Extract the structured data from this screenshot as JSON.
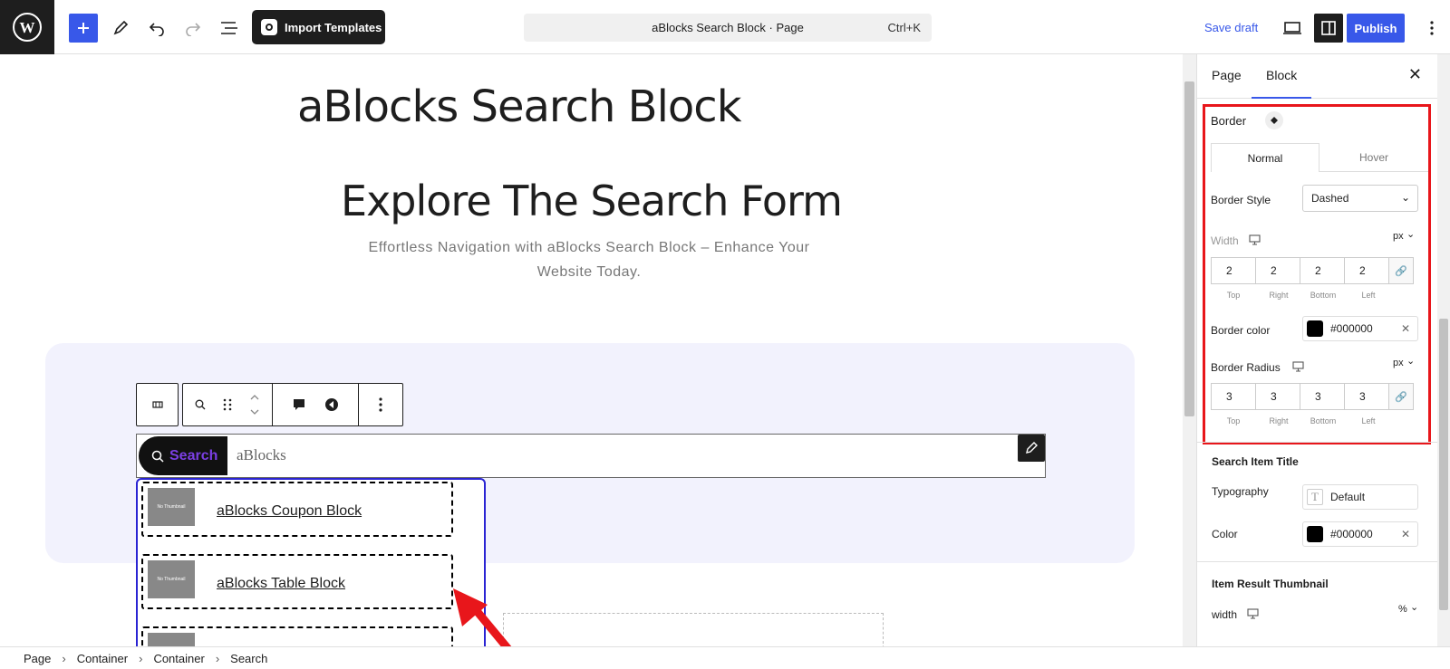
{
  "topbar": {
    "import_label": "Import Templates",
    "command_title": "aBlocks Search Block · Page",
    "command_shortcut": "Ctrl+K",
    "save_draft": "Save draft",
    "publish": "Publish"
  },
  "canvas": {
    "post_title": "aBlocks Search Block",
    "heading": "Explore The Search Form",
    "subtext": "Effortless Navigation with aBlocks Search Block – Enhance Your Website Today.",
    "search_button": "Search",
    "search_value": "aBlocks",
    "thumb_placeholder": "No Thumbnail",
    "results": [
      {
        "title": "aBlocks Coupon Block"
      },
      {
        "title": "aBlocks Table Block"
      },
      {
        "title": ""
      }
    ]
  },
  "panel": {
    "tabs": [
      "Page",
      "Block"
    ],
    "active_tab": "Block",
    "border": {
      "title": "Border",
      "tabs": [
        "Normal",
        "Hover"
      ],
      "active_tab": "Normal",
      "style_label": "Border Style",
      "style_value": "Dashed",
      "width_label": "Width",
      "width_unit": "px",
      "width_values": [
        "2",
        "2",
        "2",
        "2"
      ],
      "sides": [
        "Top",
        "Right",
        "Bottom",
        "Left"
      ],
      "color_label": "Border color",
      "color_value": "#000000",
      "radius_label": "Border Radius",
      "radius_unit": "px",
      "radius_values": [
        "3",
        "3",
        "3",
        "3"
      ]
    },
    "search_item_title": {
      "title": "Search Item Title",
      "typography_label": "Typography",
      "typography_value": "Default",
      "color_label": "Color",
      "color_value": "#000000"
    },
    "thumbnail": {
      "title": "Item Result Thumbnail",
      "width_label": "width",
      "width_unit": "%"
    }
  },
  "breadcrumb": [
    "Page",
    "Container",
    "Container",
    "Search"
  ],
  "colors": {
    "accent": "#3858e9",
    "highlight": "#e8161b",
    "selection": "#2a24d3",
    "search_text": "#7b3fe4"
  }
}
